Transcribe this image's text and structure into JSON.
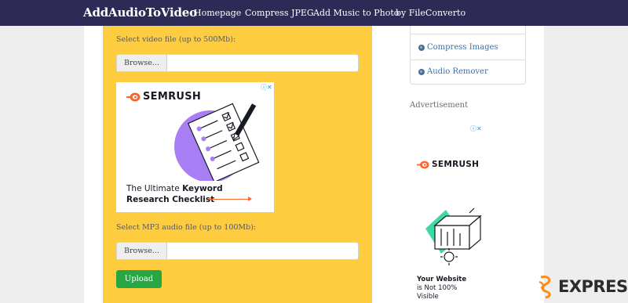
{
  "navbar": {
    "brand": "AddAudioToVideo",
    "links": [
      "Homepage",
      "Compress JPEG",
      "Add Music to Photo",
      "by FileConverto"
    ]
  },
  "form": {
    "video_label": "Select video file (up to 500Mb):",
    "audio_label": "Select MP3 audio file (up to 100Mb):",
    "browse_label": "Browse...",
    "upload_label": "Upload"
  },
  "ad_main": {
    "brand": "SEMRUSH",
    "headline_plain": "The Ultimate ",
    "headline_bold_1": "Keyword",
    "headline_bold_2": "Research Checklist"
  },
  "sidebar": {
    "items": [
      {
        "label": "Compress Images"
      },
      {
        "label": "Audio Remover"
      }
    ],
    "advertisement_label": "Advertisement"
  },
  "ad_side": {
    "brand": "SEMRUSH",
    "text_line1": "Your Website",
    "text_line2": "is Not 100%",
    "text_line3": "Visible"
  },
  "watermark": {
    "text": "EXPRESS"
  },
  "colors": {
    "navbar": "#2e2a56",
    "panel": "#fecc3f",
    "upload": "#27a744",
    "semrush_orange": "#ff642d",
    "semrush_purple": "#a87ef4",
    "link": "#3f6fa0"
  }
}
